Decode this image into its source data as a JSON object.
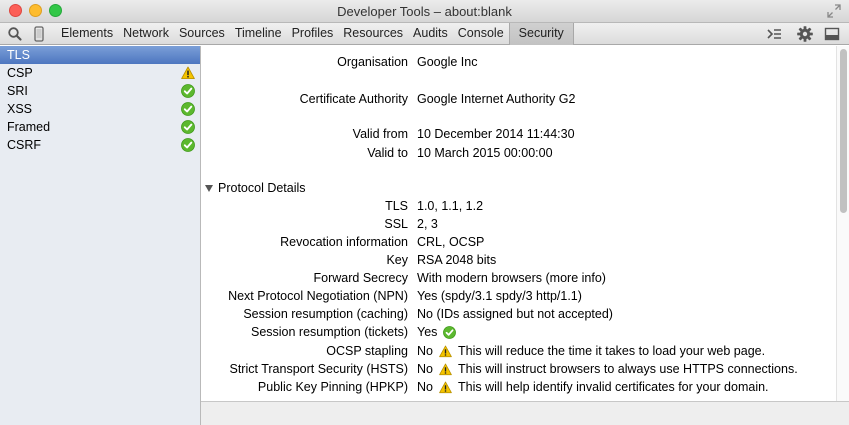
{
  "window": {
    "title": "Developer Tools – about:blank"
  },
  "toolbar": {
    "icons": [
      "search-icon",
      "device-icon",
      "console-drawer-icon",
      "gear-icon",
      "dock-icon"
    ],
    "tabs": [
      "Elements",
      "Network",
      "Sources",
      "Timeline",
      "Profiles",
      "Resources",
      "Audits",
      "Console",
      "Security"
    ],
    "active_tab": "Security"
  },
  "sidebar": {
    "items": [
      {
        "label": "TLS",
        "selected": true,
        "status": ""
      },
      {
        "label": "CSP",
        "status": "warning-icon"
      },
      {
        "label": "SRI",
        "status": "check-icon"
      },
      {
        "label": "XSS",
        "status": "check-icon"
      },
      {
        "label": "Framed",
        "status": "check-icon"
      },
      {
        "label": "CSRF",
        "status": "check-icon"
      }
    ]
  },
  "certificate": {
    "organisation_label": "Organisation",
    "organisation_value": "Google Inc",
    "ca_label": "Certificate Authority",
    "ca_value": "Google Internet Authority G2",
    "valid_from_label": "Valid from",
    "valid_from_value": "10 December 2014 11:44:30",
    "valid_to_label": "Valid to",
    "valid_to_value": "10 March 2015 00:00:00"
  },
  "protocol": {
    "section_title": "Protocol Details",
    "rows": [
      {
        "label": "TLS",
        "value": "1.0, 1.1, 1.2"
      },
      {
        "label": "SSL",
        "value": "2, 3"
      },
      {
        "label": "Revocation information",
        "value": "CRL, OCSP"
      },
      {
        "label": "Key",
        "value": "RSA 2048 bits"
      },
      {
        "label": "Forward Secrecy",
        "value": "With modern browsers (more info)"
      },
      {
        "label": "Next Protocol Negotiation (NPN)",
        "value": "Yes (spdy/3.1 spdy/3 http/1.1)"
      },
      {
        "label": "Session resumption (caching)",
        "value": "No (IDs assigned but not accepted)"
      },
      {
        "label": "Session resumption (tickets)",
        "value": "Yes",
        "icon": "check-icon"
      },
      {
        "label": "OCSP stapling",
        "value": "No",
        "icon": "warning-icon",
        "message": "This will reduce the time it takes to load your web page."
      },
      {
        "label": "Strict Transport Security (HSTS)",
        "value": "No",
        "icon": "warning-icon",
        "message": "This will instruct browsers to always use HTTPS connections."
      },
      {
        "label": "Public Key Pinning (HPKP)",
        "value": "No",
        "icon": "warning-icon",
        "message": "This will help identify invalid certificates for your domain."
      }
    ]
  },
  "colors": {
    "selection": "#5c82c4",
    "sidebar_bg": "#e8ecf2",
    "check": "#5cb82e",
    "warning": "#f5c400"
  }
}
